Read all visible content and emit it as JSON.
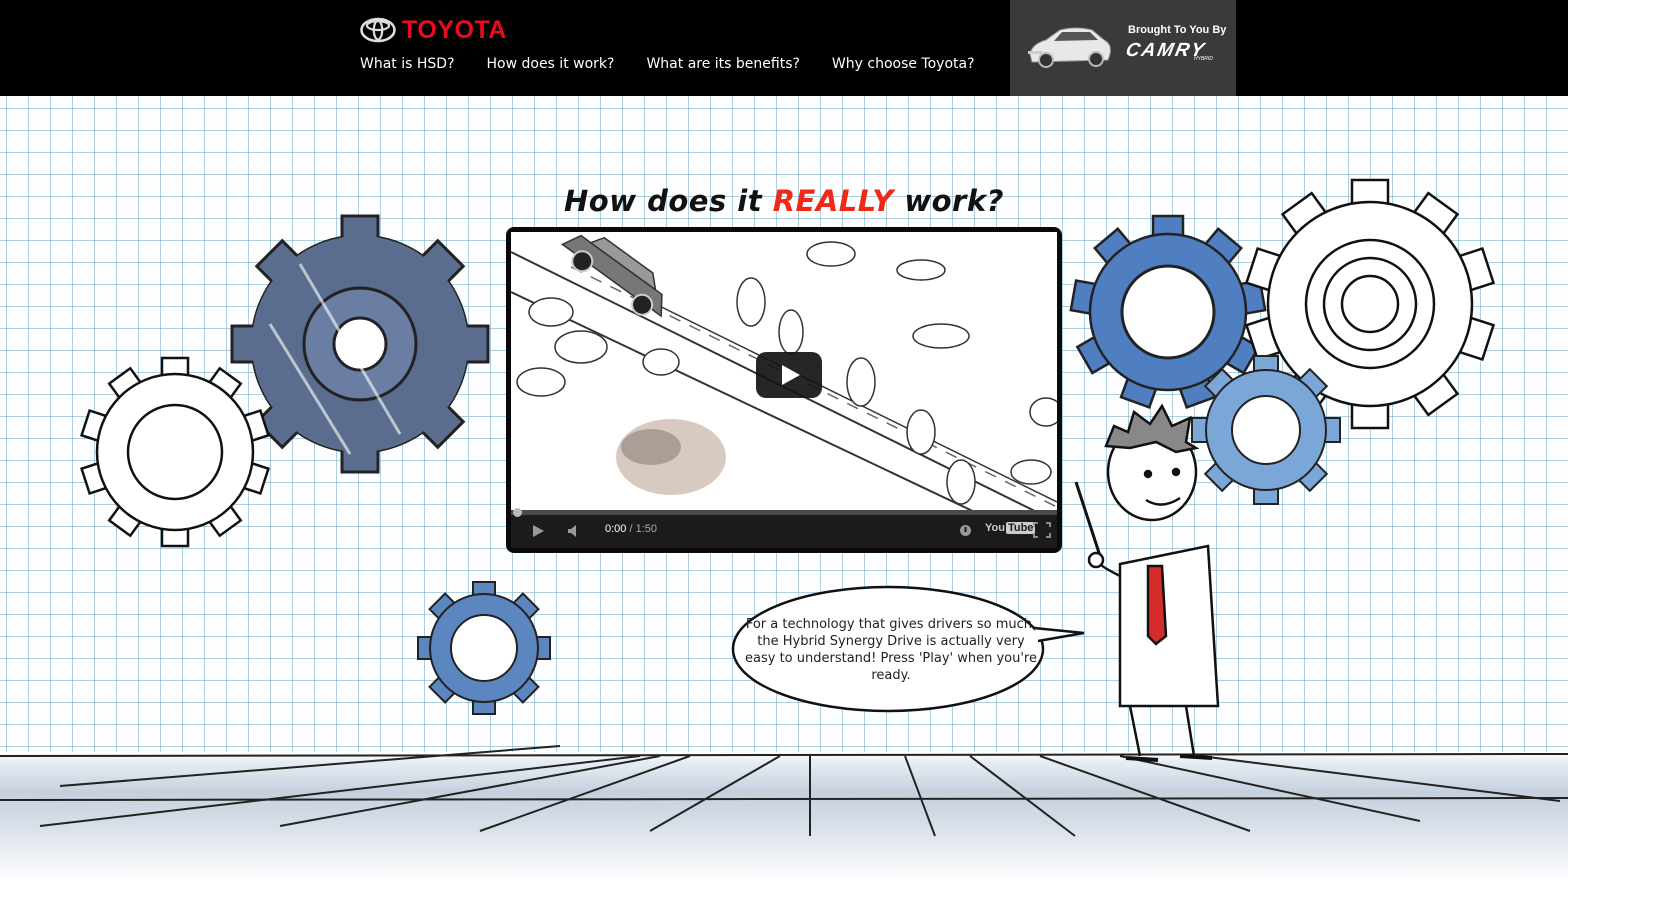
{
  "brand": {
    "logo_text": "TOYOTA",
    "color": "#eb0a1e"
  },
  "nav": {
    "items": [
      {
        "label": "What is HSD?"
      },
      {
        "label": "How does it work?"
      },
      {
        "label": "What are its benefits?"
      },
      {
        "label": "Why choose Toyota?"
      }
    ]
  },
  "sponsor": {
    "tagline": "Brought To You By",
    "brand": "CAMRY",
    "sub": "HYBRID"
  },
  "hero": {
    "title_before": "How does it ",
    "title_accent": "REALLY",
    "title_after": " work?",
    "accent_color": "#ee2a16"
  },
  "video": {
    "current_time": "0:00",
    "separator": " / ",
    "duration": "1:50",
    "progress": 0.0,
    "youtube_label": "You",
    "youtube_tube": "Tube"
  },
  "speech_bubble": {
    "text": "For a technology that gives drivers so much, the Hybrid Synergy Drive is actually very easy to understand! Press 'Play' when you're ready."
  },
  "colors": {
    "gear_dark": "#5b6d8f",
    "gear_blue": "#5b86c0",
    "gear_light": "#7aa6d8",
    "header_bg": "#000000"
  },
  "icons": [
    "toyota-emblem-icon",
    "play-icon",
    "volume-icon",
    "settings-icon",
    "fullscreen-icon",
    "youtube-logo"
  ]
}
